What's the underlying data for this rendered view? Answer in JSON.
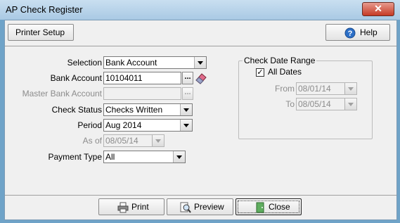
{
  "window": {
    "title": "AP Check Register",
    "close_glyph": "✕"
  },
  "toolbar": {
    "printer_setup_label": "Printer Setup",
    "help_label": "Help"
  },
  "form": {
    "selection": {
      "label": "Selection",
      "value": "Bank Account"
    },
    "bank_account": {
      "label": "Bank Account",
      "value": "10104011"
    },
    "master_bank_account": {
      "label": "Master Bank Account",
      "value": ""
    },
    "check_status": {
      "label": "Check Status",
      "value": "Checks Written"
    },
    "period": {
      "label": "Period",
      "value": "Aug 2014"
    },
    "as_of": {
      "label": "As of",
      "value": "08/05/14"
    },
    "payment_type": {
      "label": "Payment Type",
      "value": "All"
    },
    "ellipsis": "..."
  },
  "date_range": {
    "title": "Check Date Range",
    "all_dates_label": "All Dates",
    "all_dates_checked": true,
    "check_glyph": "✓",
    "from": {
      "label": "From",
      "value": "08/01/14"
    },
    "to": {
      "label": "To",
      "value": "08/05/14"
    }
  },
  "actions": {
    "print_label": "Print",
    "preview_label": "Preview",
    "close_label": "Close"
  },
  "icons": {
    "help": "help-icon",
    "eraser": "eraser-icon",
    "printer": "printer-icon",
    "preview": "magnifier-icon",
    "close": "door-icon"
  }
}
